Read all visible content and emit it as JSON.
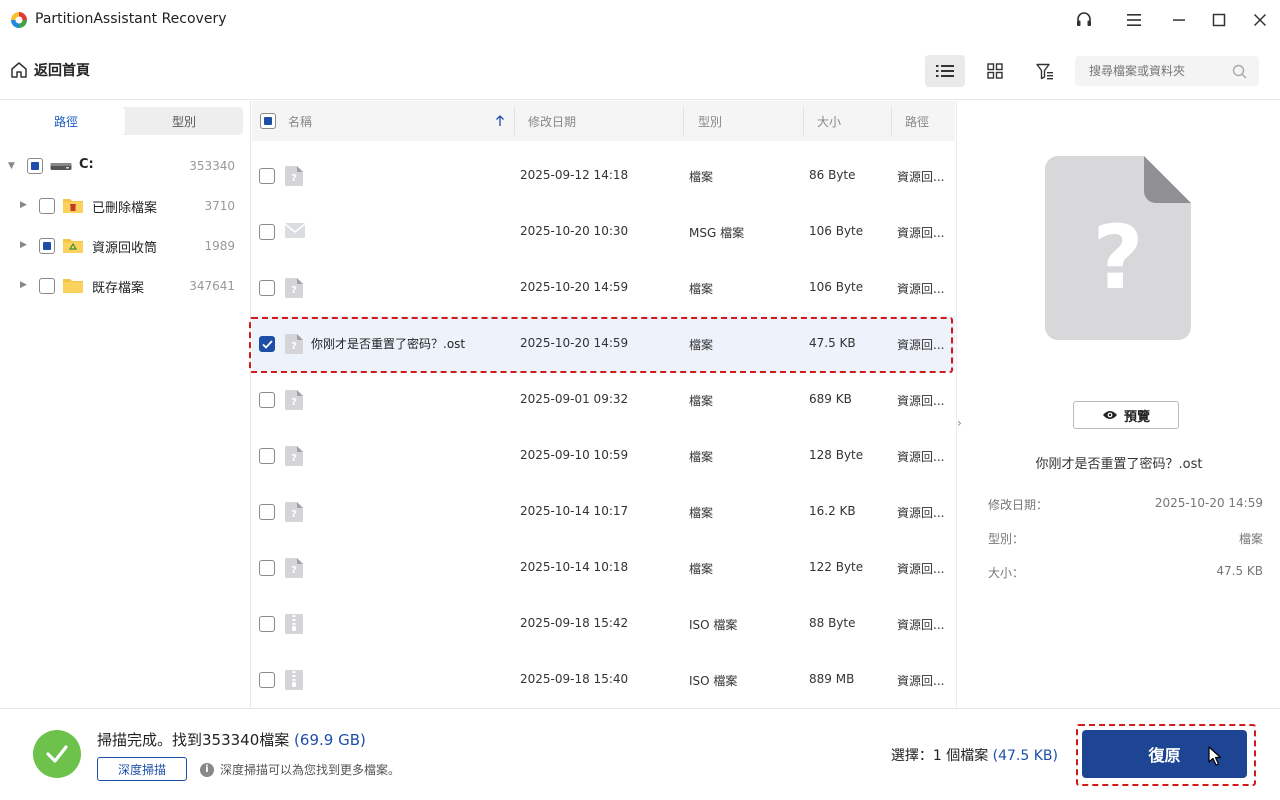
{
  "app": {
    "title": "PartitionAssistant Recovery",
    "accent_color": "#1d4fa8",
    "danger_color": "#d11a1a"
  },
  "titlebar": {
    "icons": [
      "headset-icon",
      "menu-icon",
      "minimize-icon",
      "maximize-icon",
      "close-icon"
    ]
  },
  "toolbar": {
    "home_label": "返回首頁",
    "search_placeholder": "搜尋檔案或資料夾",
    "views": [
      "list-view-icon",
      "grid-view-icon",
      "filter-icon"
    ]
  },
  "left_panel": {
    "tabs": [
      {
        "label": "路徑",
        "active": true
      },
      {
        "label": "型別",
        "active": false
      }
    ],
    "tree": [
      {
        "label": "C:",
        "count": "353340",
        "state": "partial",
        "icon": "drive-icon",
        "level": 0
      },
      {
        "label": "已刪除檔案",
        "count": "3710",
        "state": "unchecked",
        "icon": "deleted-folder-icon",
        "level": 1
      },
      {
        "label": "資源回收筒",
        "count": "1989",
        "state": "partial",
        "icon": "recycle-bin-folder-icon",
        "level": 1
      },
      {
        "label": "既存檔案",
        "count": "347641",
        "state": "unchecked",
        "icon": "folder-icon",
        "level": 1
      }
    ]
  },
  "file_list": {
    "columns": {
      "name": "名稱",
      "date": "修改日期",
      "type": "型別",
      "size": "大小",
      "path": "路徑"
    },
    "rows": [
      {
        "name": "",
        "date": "2025-09-12 14:18",
        "type": "檔案",
        "size": "86 Byte",
        "path": "資源回...",
        "icon": "unknown-file-icon",
        "checked": false
      },
      {
        "name": "",
        "date": "2025-10-20 10:30",
        "type": "MSG 檔案",
        "size": "106 Byte",
        "path": "資源回...",
        "icon": "mail-file-icon",
        "checked": false
      },
      {
        "name": "",
        "date": "2025-10-20 14:59",
        "type": "檔案",
        "size": "106 Byte",
        "path": "資源回...",
        "icon": "unknown-file-icon",
        "checked": false
      },
      {
        "name": "你刚才是否重置了密码？.ost",
        "date": "2025-10-20 14:59",
        "type": "檔案",
        "size": "47.5 KB",
        "path": "資源回...",
        "icon": "unknown-file-icon",
        "checked": true
      },
      {
        "name": "",
        "date": "2025-09-01 09:32",
        "type": "檔案",
        "size": "689 KB",
        "path": "資源回...",
        "icon": "unknown-file-icon",
        "checked": false
      },
      {
        "name": "",
        "date": "2025-09-10 10:59",
        "type": "檔案",
        "size": "128 Byte",
        "path": "資源回...",
        "icon": "unknown-file-icon",
        "checked": false
      },
      {
        "name": "",
        "date": "2025-10-14 10:17",
        "type": "檔案",
        "size": "16.2 KB",
        "path": "資源回...",
        "icon": "unknown-file-icon",
        "checked": false
      },
      {
        "name": "",
        "date": "2025-10-14 10:18",
        "type": "檔案",
        "size": "122 Byte",
        "path": "資源回...",
        "icon": "unknown-file-icon",
        "checked": false
      },
      {
        "name": "",
        "date": "2025-09-18 15:42",
        "type": "ISO 檔案",
        "size": "88 Byte",
        "path": "資源回...",
        "icon": "archive-file-icon",
        "checked": false
      },
      {
        "name": "",
        "date": "2025-09-18 15:40",
        "type": "ISO 檔案",
        "size": "889 MB",
        "path": "資源回...",
        "icon": "archive-file-icon",
        "checked": false
      }
    ]
  },
  "preview": {
    "button_label": "預覽",
    "file_name": "你刚才是否重置了密码？.ost",
    "details": [
      {
        "label": "修改日期：",
        "value": "2025-10-20 14:59"
      },
      {
        "label": "型別：",
        "value": "檔案"
      },
      {
        "label": "大小：",
        "value": "47.5 KB"
      }
    ]
  },
  "footer": {
    "status_prefix": "掃描完成。找到353340檔案",
    "status_size": "(69.9 GB)",
    "deep_scan_label": "深度掃描",
    "deep_scan_hint": "深度掃描可以為您找到更多檔案。",
    "selection_prefix": "選擇：1 個檔案",
    "selection_size": "(47.5 KB)",
    "recover_label": "復原"
  }
}
